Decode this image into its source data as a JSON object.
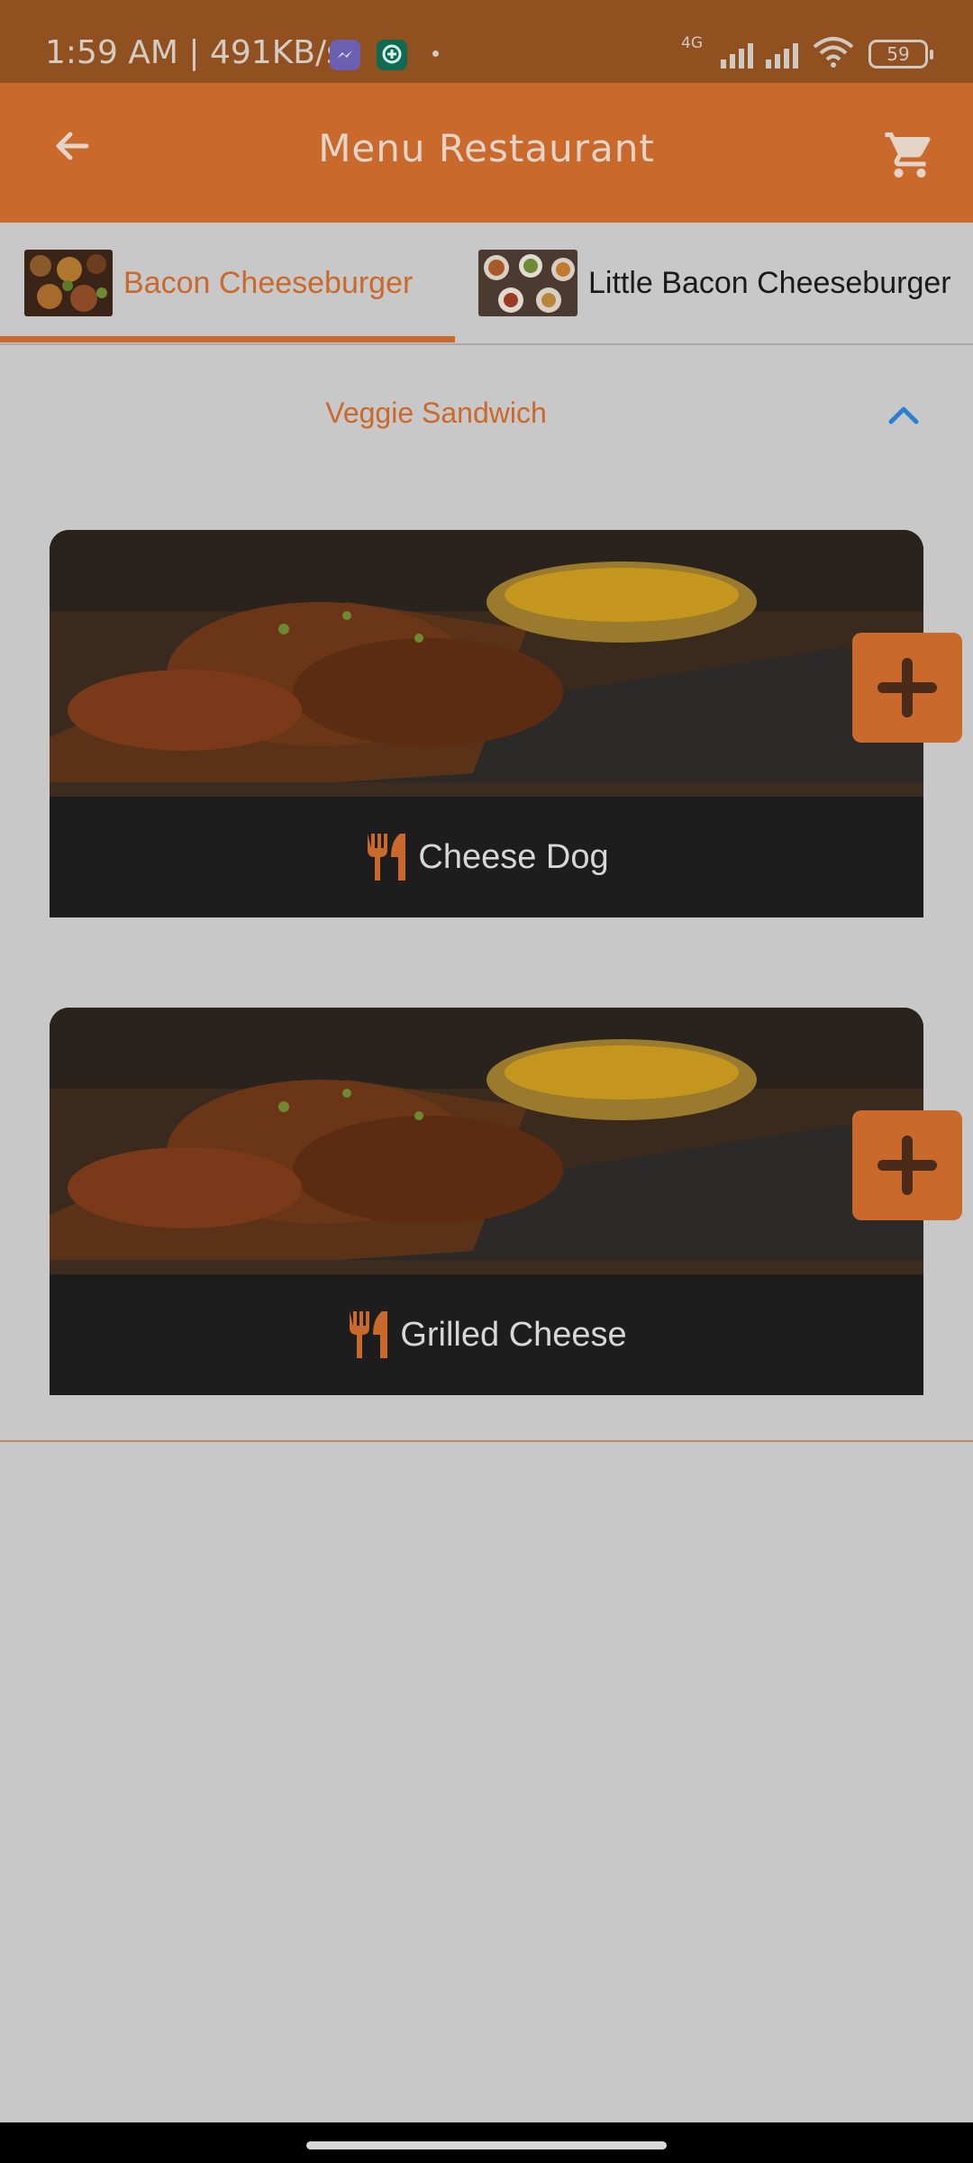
{
  "status_bar": {
    "time_speed": "1:59 AM | 491KB/s",
    "network_type": "4G",
    "battery_level": "59",
    "icons": [
      "messenger-icon",
      "chat-app-icon",
      "signal-icon",
      "wifi-icon",
      "battery-icon"
    ]
  },
  "app_bar": {
    "title": "Menu Restaurant",
    "back_icon": "arrow-left-icon",
    "cart_icon": "shopping-cart-icon"
  },
  "tabs": [
    {
      "label": "Bacon Cheeseburger",
      "active": true
    },
    {
      "label": "Little Bacon Cheeseburger",
      "active": false
    }
  ],
  "section": {
    "title": "Veggie Sandwich",
    "expanded_icon": "chevron-up-icon"
  },
  "items": [
    {
      "name": "Cheese Dog",
      "icon": "cutlery-icon",
      "action_icon": "plus-icon"
    },
    {
      "name": "Grilled Cheese",
      "icon": "cutlery-icon",
      "action_icon": "plus-icon"
    }
  ],
  "colors": {
    "primary": "#c9692b",
    "status_bar": "#915020",
    "background": "#c8c8c8",
    "card_footer": "#1e1d1e",
    "accent_blue": "#2a7fd0"
  }
}
